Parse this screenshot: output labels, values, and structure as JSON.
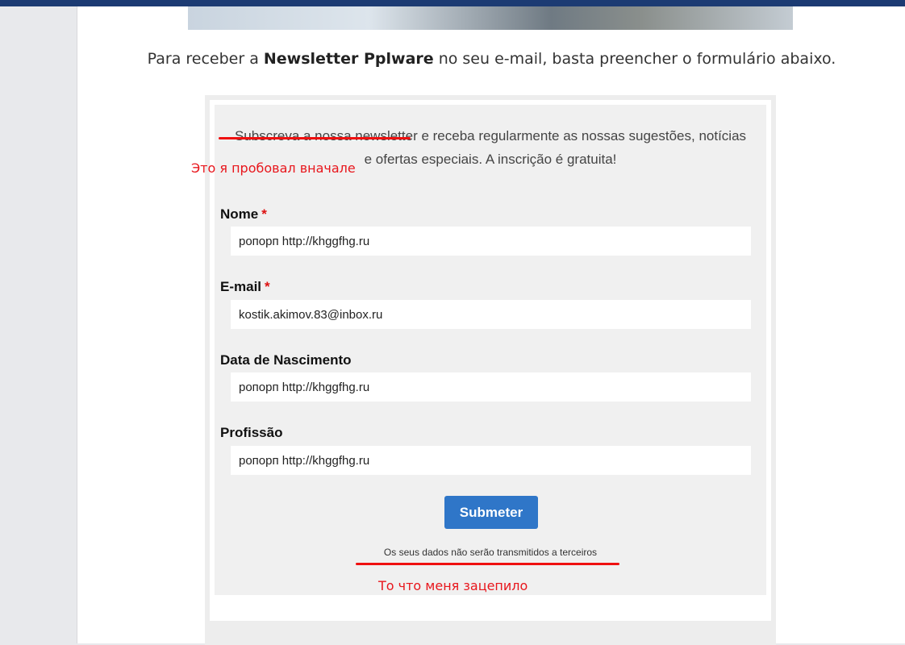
{
  "header": {
    "accent_color": "#1c3b73"
  },
  "intro": {
    "before": "Para receber a ",
    "bold": "Newsletter Pplware",
    "after": " no seu e-mail, basta preencher o formulário abaixo."
  },
  "form": {
    "subtitle_line1": "Subscreva a nossa newsletter e receba regularmente as nossas sugestões, notícias",
    "subtitle_line2": "e ofertas especiais. A inscrição é gratuita!",
    "fields": [
      {
        "label": "Nome",
        "required": "*",
        "value": "ропорп http://khggfhg.ru"
      },
      {
        "label": "E-mail",
        "required": "*",
        "value": "kostik.akimov.83@inbox.ru"
      },
      {
        "label": "Data de Nascimento",
        "value": "ропорп http://khggfhg.ru"
      },
      {
        "label": "Profissão",
        "value": "ропорп http://khggfhg.ru"
      }
    ],
    "submit_label": "Submeter",
    "privacy_note": "Os seus dados não serão transmitidos a terceiros",
    "button_color": "#2f76c8"
  },
  "annotations": {
    "first_note": "Это я пробовал вначале",
    "second_note": "То что меня зацепило",
    "color": "#e8161c"
  }
}
